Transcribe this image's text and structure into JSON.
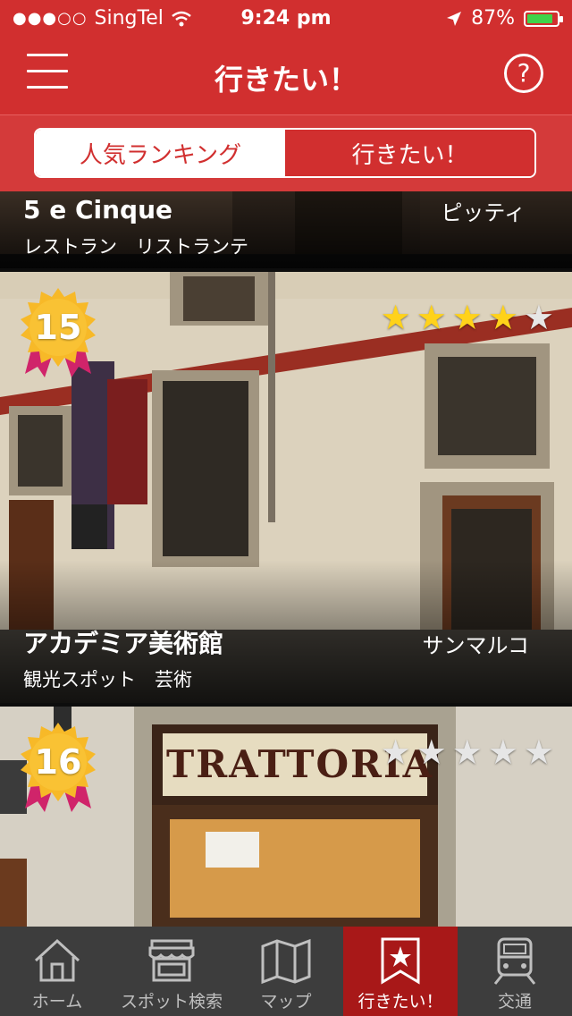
{
  "status_bar": {
    "signal": "●●●○○",
    "carrier": "SingTel",
    "time": "9:24 pm",
    "battery_percent": "87%",
    "battery_level": 0.87
  },
  "nav": {
    "title": "行きたい！",
    "menu_icon": "hamburger-menu-icon",
    "help_icon": "help-icon",
    "help_glyph": "?"
  },
  "segment": {
    "tabs": [
      {
        "label": "人気ランキング",
        "selected": true
      },
      {
        "label": "行きたい！",
        "selected": false
      }
    ]
  },
  "items": [
    {
      "name": "5 e Cinque",
      "area": "ピッティ",
      "category": "レストラン　リストランテ"
    },
    {
      "rank": "15",
      "name": "アカデミア美術館",
      "area": "サンマルコ",
      "category": "観光スポット　芸術",
      "rating": 4
    },
    {
      "rank": "16",
      "rating": 0,
      "sign_text": "TRATTORIA"
    }
  ],
  "tab_bar": {
    "tabs": [
      {
        "label": "ホーム",
        "icon": "home-icon"
      },
      {
        "label": "スポット検索",
        "icon": "storefront-icon"
      },
      {
        "label": "マップ",
        "icon": "map-icon"
      },
      {
        "label": "行きたい！",
        "icon": "bookmark-star-icon",
        "active": true
      },
      {
        "label": "交通",
        "icon": "train-icon"
      }
    ]
  },
  "colors": {
    "brand_red": "#d12f2f",
    "active_tab": "#a81818",
    "star_on": "#ffd21a",
    "star_off": "#e6e6e6",
    "badge_gold": "#f7b928",
    "ribbon_pink": "#d0246a"
  }
}
